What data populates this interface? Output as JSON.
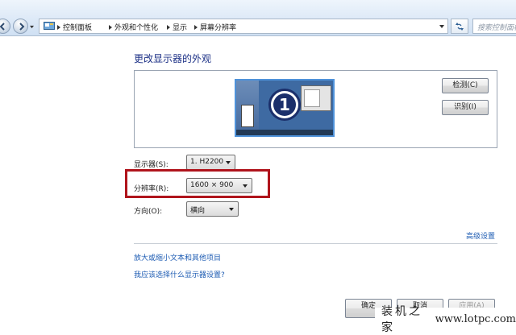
{
  "address_bar": {
    "breadcrumbs": [
      "控制面板",
      "外观和个性化",
      "显示",
      "屏幕分辨率"
    ],
    "search_placeholder": "搜索控制面板"
  },
  "main": {
    "title": "更改显示器的外观",
    "monitor_number": "1",
    "detect_button": "检测(C)",
    "identify_button": "识别(I)",
    "display": {
      "label": "显示器(S):",
      "value": "1. H2200"
    },
    "resolution": {
      "label": "分辨率(R):",
      "value": "1600 × 900"
    },
    "orientation": {
      "label": "方向(O):",
      "value": "横向"
    },
    "advanced_link": "高级设置",
    "links": [
      "放大或缩小文本和其他项目",
      "我应该选择什么显示器设置?"
    ]
  },
  "footer": {
    "ok": "确定",
    "cancel": "取消",
    "apply": "应用(A)"
  },
  "watermark": {
    "site_name": "装机之家",
    "url": "www.lotpc.com"
  },
  "colors": {
    "title": "#1e3287",
    "link": "#1e5cb3",
    "highlight": "#b0141c",
    "monitor_border": "#4f92d9"
  }
}
